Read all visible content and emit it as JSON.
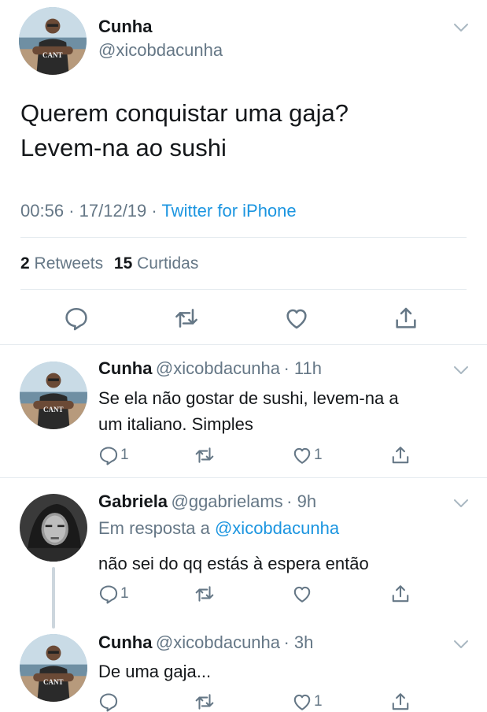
{
  "main_tweet": {
    "display_name": "Cunha",
    "handle": "@xicobdacunha",
    "text_line1": "Querem conquistar uma gaja?",
    "text_line2": "Levem-na ao sushi",
    "time": "00:56",
    "date": "17/12/19",
    "separator": "·",
    "source": "Twitter for iPhone",
    "retweets_count": "2",
    "retweets_label": "Retweets",
    "likes_count": "15",
    "likes_label": "Curtidas"
  },
  "replies": [
    {
      "display_name": "Cunha",
      "handle": "@xicobdacunha",
      "time_ago": "· 11h",
      "reply_to_label": "",
      "reply_to_handle": "",
      "text_line1": "Se ela não gostar de sushi, levem-na a",
      "text_line2": "um italiano. Simples",
      "reply_count": "1",
      "retweet_count": "",
      "like_count": "1"
    },
    {
      "display_name": "Gabriela",
      "handle": "@ggabrielams",
      "time_ago": "· 9h",
      "reply_to_label": "Em resposta a",
      "reply_to_handle": "@xicobdacunha",
      "text_line1": "não sei do qq estás à espera então",
      "text_line2": "",
      "reply_count": "1",
      "retweet_count": "",
      "like_count": ""
    },
    {
      "display_name": "Cunha",
      "handle": "@xicobdacunha",
      "time_ago": "· 3h",
      "reply_to_label": "",
      "reply_to_handle": "",
      "text_line1": "De uma gaja...",
      "text_line2": "",
      "reply_count": "",
      "retweet_count": "",
      "like_count": "1"
    }
  ],
  "avatar_shirt_text": "CANT",
  "colors": {
    "text": "#14171a",
    "muted": "#657786",
    "link": "#1b95e0",
    "divider": "#e6ecf0"
  },
  "icons": [
    "chevron-down-icon",
    "reply-icon",
    "retweet-icon",
    "like-icon",
    "share-icon"
  ]
}
